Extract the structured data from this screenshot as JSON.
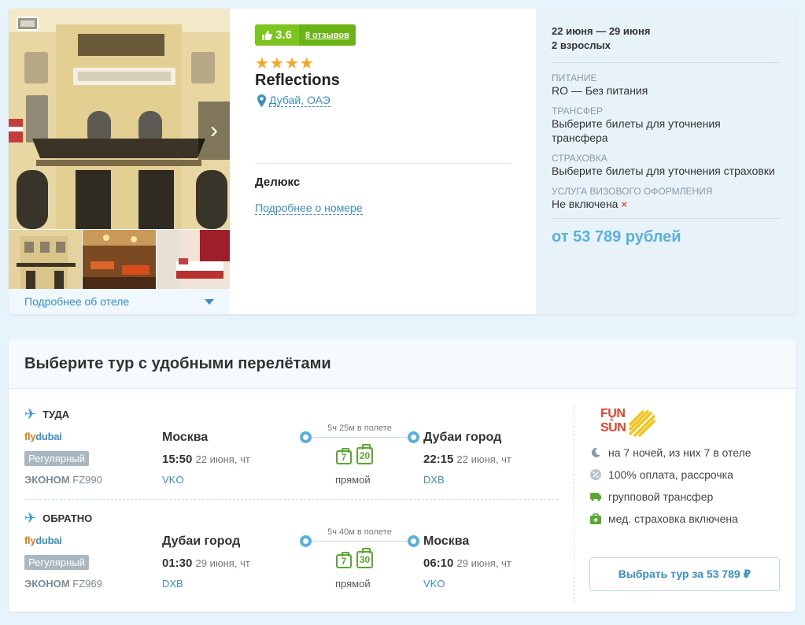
{
  "hotel": {
    "rating_score": "3.6",
    "reviews_label": "8 отзывов",
    "stars": "★★★★",
    "name": "Reflections",
    "location": "Дубай, ОАЭ",
    "room_type": "Делюкс",
    "room_more_label": "Подробнее о номере",
    "hotel_more_label": "Подробнее об отеле"
  },
  "booking": {
    "dates": "22 июня — 29 июня",
    "guests": "2 взрослых",
    "meal_label": "ПИТАНИЕ",
    "meal_value": "RO — Без питания",
    "transfer_label": "ТРАНСФЕР",
    "transfer_value": "Выберите билеты для уточнения трансфера",
    "insurance_label": "СТРАХОВКА",
    "insurance_value": "Выберите билеты для уточнения страховки",
    "visa_label": "УСЛУГА ВИЗОВОГО ОФОРМЛЕНИЯ",
    "visa_value": "Не включена",
    "price_from": "от 53 789 рублей"
  },
  "tour": {
    "title": "Выберите тур с удобными перелётами",
    "outbound": {
      "direction": "ТУДА",
      "airline_a": "fly",
      "airline_b": "dubai",
      "fare_badge": "Регулярный",
      "cabin": "ЭКОНОМ",
      "flight_no": "FZ990",
      "from_city": "Москва",
      "from_time": "15:50",
      "from_date": "22 июня, чт",
      "from_code": "VKO",
      "duration": "5ч 25м в полете",
      "hand_bag": "7",
      "luggage": "20",
      "stops": "прямой",
      "to_city": "Дубаи город",
      "to_time": "22:15",
      "to_date": "22 июня, чт",
      "to_code": "DXB"
    },
    "inbound": {
      "direction": "ОБРАТНО",
      "airline_a": "fly",
      "airline_b": "dubai",
      "fare_badge": "Регулярный",
      "cabin": "ЭКОНОМ",
      "flight_no": "FZ969",
      "from_city": "Дубаи город",
      "from_time": "01:30",
      "from_date": "29 июня, чт",
      "from_code": "DXB",
      "duration": "5ч 40м в полете",
      "hand_bag": "7",
      "luggage": "30",
      "stops": "прямой",
      "to_city": "Москва",
      "to_time": "06:10",
      "to_date": "29 июня, чт",
      "to_code": "VKO"
    },
    "operator": {
      "line1": "FUN",
      "amp": "&",
      "line2": "SUN"
    },
    "features": [
      "на 7 ночей, из них 7 в отеле",
      "100% оплата, рассрочка",
      "групповой трансфер",
      "мед. страховка включена"
    ],
    "buy_button": "Выбрать тур за 53 789 ₽"
  },
  "colors": {
    "accent": "#3a8fc4",
    "rating": "#7cc520",
    "price": "#5ab0e0",
    "baggage": "#59a832"
  }
}
